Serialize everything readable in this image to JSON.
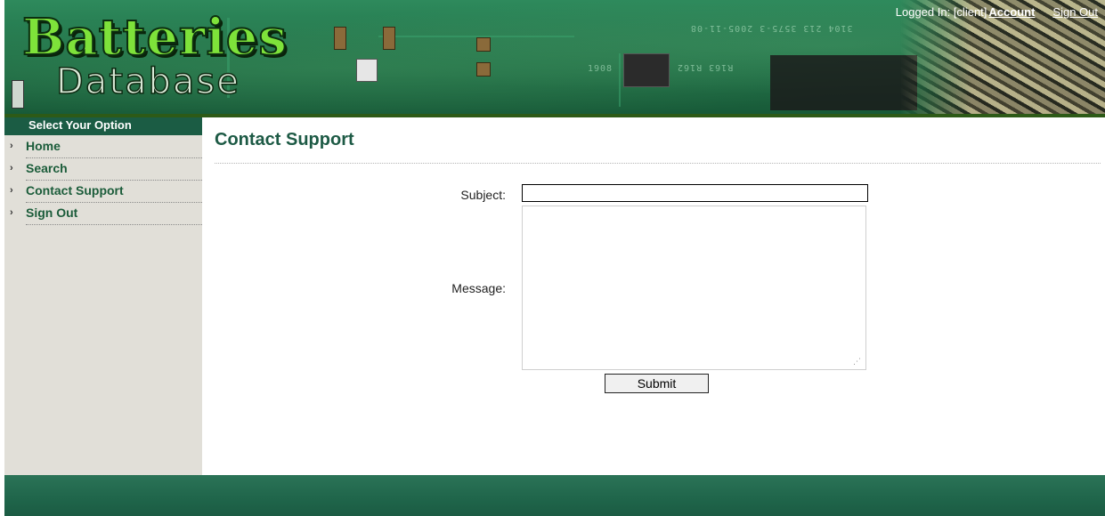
{
  "header": {
    "logo_line1": "Batteries",
    "logo_line2": "Database",
    "logged_in_text": "Logged In: [client]",
    "account_link": "Account",
    "sign_out_link": "Sign Out",
    "pcb_text_1": "3104 213 3575-3 2005-11-08",
    "pcb_text_2": "R163 R162",
    "pcb_text_3": "1908"
  },
  "sidebar": {
    "title": "Select Your Option",
    "arrow_glyph": "›",
    "items": [
      {
        "label": "Home"
      },
      {
        "label": "Search"
      },
      {
        "label": "Contact Support"
      },
      {
        "label": "Sign Out"
      }
    ]
  },
  "main": {
    "title": "Contact Support",
    "form": {
      "subject_label": "Subject:",
      "subject_value": "",
      "message_label": "Message:",
      "message_value": "",
      "submit_label": "Submit"
    }
  },
  "colors": {
    "brand_green": "#1b5c44",
    "title_green": "#1d5a45",
    "sidebar_bg": "#e1dfd8",
    "footer_green": "#1f654a"
  }
}
